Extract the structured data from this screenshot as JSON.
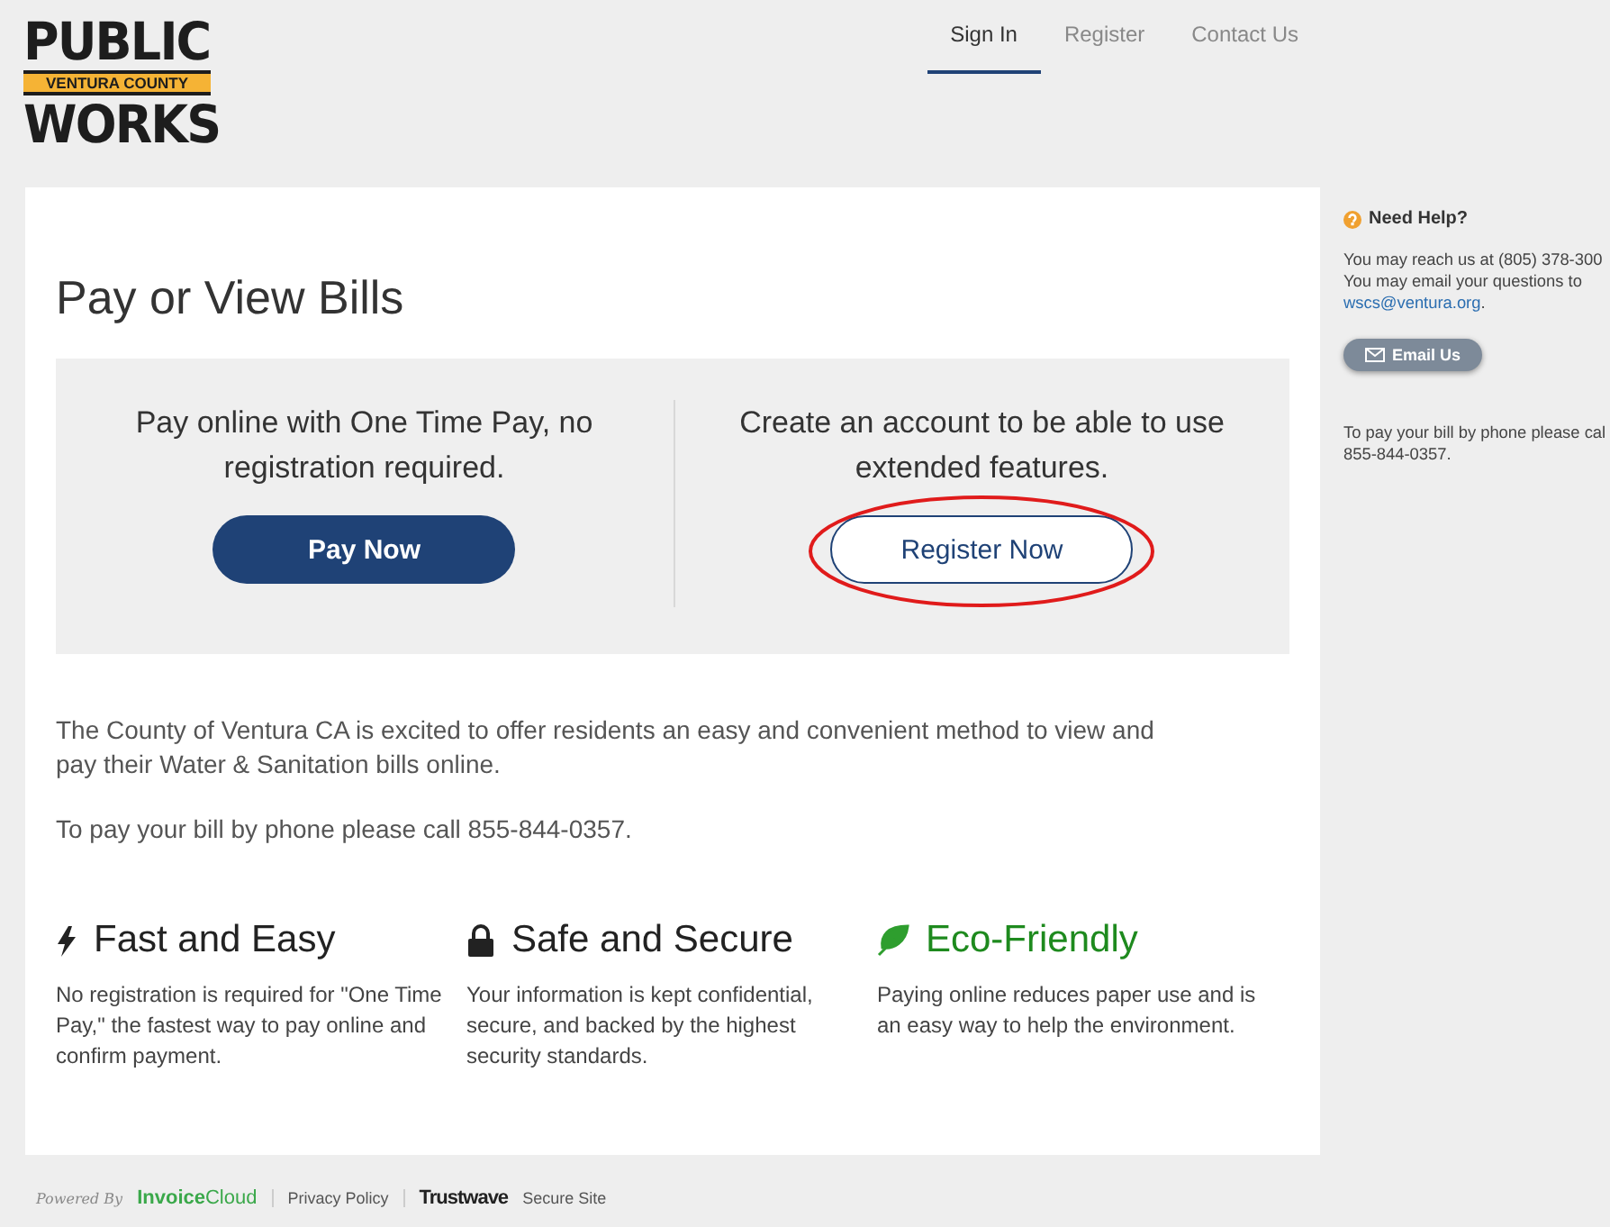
{
  "logo": {
    "top": "PUBLIC",
    "band": "VENTURA COUNTY",
    "bottom": "WORKS"
  },
  "nav": [
    {
      "label": "Sign In",
      "selected": true
    },
    {
      "label": "Register",
      "selected": false
    },
    {
      "label": "Contact Us",
      "selected": false
    }
  ],
  "title": "Pay or View Bills",
  "options": [
    {
      "text": "Pay online with One Time Pay, no registration required.",
      "button": "Pay Now",
      "kind": "primary",
      "circled": false
    },
    {
      "text": "Create an account to be able to use extended features.",
      "button": "Register Now",
      "kind": "outline",
      "circled": true
    }
  ],
  "intro": [
    "The County of Ventura CA is excited to offer residents an easy and convenient method to view and pay their Water & Sanitation bills online.",
    "To pay your bill by phone please call 855-844-0357."
  ],
  "features": [
    {
      "kind": "bolt",
      "title": "Fast and Easy",
      "color": "#222222",
      "text": "No registration is required for \"One Time Pay,\" the fastest way to pay online and confirm payment."
    },
    {
      "kind": "lock",
      "title": "Safe and Secure",
      "color": "#222222",
      "text": "Your information is kept confidential, secure, and backed by the highest security standards."
    },
    {
      "kind": "leaf",
      "title": "Eco-Friendly",
      "color": "#1e8a1e",
      "text": "Paying online reduces paper use and is an easy way to help the environment."
    }
  ],
  "help": {
    "title": "Need Help?",
    "lines": [
      "You may reach us at (805) 378-300",
      "You may email your questions to"
    ],
    "email": "wscs@ventura.org",
    "after_email": ".",
    "button": "Email Us",
    "phone_lines": [
      "To pay your bill by phone please cal",
      "855-844-0357."
    ]
  },
  "footer": {
    "powered": "Powered By",
    "brand_a": "Invoice",
    "brand_b": "Cloud",
    "privacy": "Privacy Policy",
    "trust": "Trustwave",
    "secure": "Secure Site"
  }
}
